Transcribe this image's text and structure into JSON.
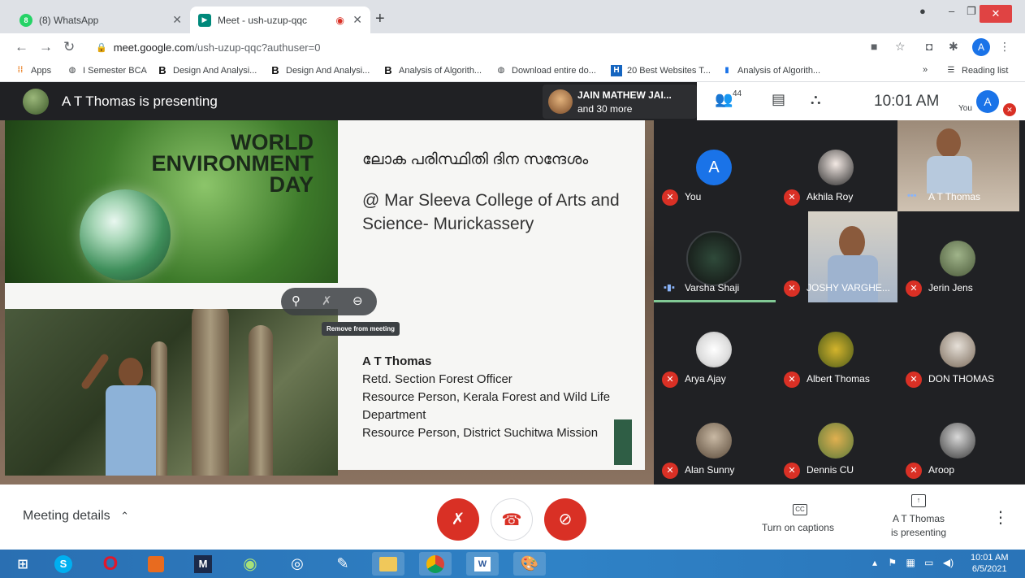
{
  "browser": {
    "tabs": [
      {
        "label": "(8) WhatsApp",
        "favicon": "8",
        "favicon_color": "#25d366"
      },
      {
        "label": "Meet - ush-uzup-qqc",
        "favicon": "meet",
        "favicon_color": "#00897b"
      }
    ],
    "url_host": "meet.google.com",
    "url_path": "/ush-uzup-qqc?authuser=0",
    "profile_initial": "A",
    "bookmarks": [
      "Apps",
      "I Semester BCA",
      "Design And Analysi...",
      "Design And Analysi...",
      "Analysis of Algorith...",
      "Download entire do...",
      "20 Best Websites T...",
      "Analysis of Algorith..."
    ],
    "reading_list": "Reading list",
    "more_bookmarks": "»"
  },
  "meet": {
    "presenter_title": "A T Thomas is presenting",
    "others_name": "JAIN MATHEW JAI...",
    "others_more": "and 30 more",
    "participant_count": "44",
    "clock": "10:01 AM",
    "you_label": "You",
    "you_initial": "A"
  },
  "slide": {
    "image_title_1": "WORLD",
    "image_title_2": "ENVIRONMENT",
    "image_title_3": "DAY",
    "malayalam_heading": "ലോക പരിസ്ഥിതി ദിന സന്ദേശം",
    "college": "@ Mar Sleeva College of Arts and Science- Murickassery",
    "bio_name": "A T Thomas",
    "bio_line1": "Retd. Section Forest Officer",
    "bio_line2": "Resource Person, Kerala Forest and Wild Life Department",
    "bio_line3": "Resource Person, District Suchitwa Mission"
  },
  "tile_controls": {
    "tooltip": "Remove from meeting"
  },
  "participants": [
    {
      "name": "You",
      "avatar": "A",
      "muted": true
    },
    {
      "name": "Akhila Roy",
      "avatar": "photo",
      "muted": true
    },
    {
      "name": "A T Thomas",
      "avatar": "video",
      "muted": false
    },
    {
      "name": "Varsha Shaji",
      "avatar": "photo",
      "muted": false,
      "speaking": true
    },
    {
      "name": "JOSHY VARGHE...",
      "avatar": "video",
      "muted": true
    },
    {
      "name": "Jerin Jens",
      "avatar": "photo",
      "muted": true
    },
    {
      "name": "Arya Ajay",
      "avatar": "photo",
      "muted": true
    },
    {
      "name": "Albert Thomas",
      "avatar": "photo",
      "muted": true
    },
    {
      "name": "DON THOMAS",
      "avatar": "photo",
      "muted": true
    },
    {
      "name": "Alan Sunny",
      "avatar": "photo",
      "muted": true
    },
    {
      "name": "Dennis CU",
      "avatar": "photo",
      "muted": true
    },
    {
      "name": "Aroop",
      "avatar": "photo",
      "muted": true
    }
  ],
  "bottom": {
    "meeting_details": "Meeting details",
    "captions_label": "Turn on captions",
    "presenting_line1": "A T Thomas",
    "presenting_line2": "is presenting"
  },
  "taskbar": {
    "time": "10:01 AM",
    "date": "6/5/2021"
  },
  "colors": {
    "meet_dark": "#202124",
    "danger": "#d93025",
    "accent": "#1a73e8"
  }
}
